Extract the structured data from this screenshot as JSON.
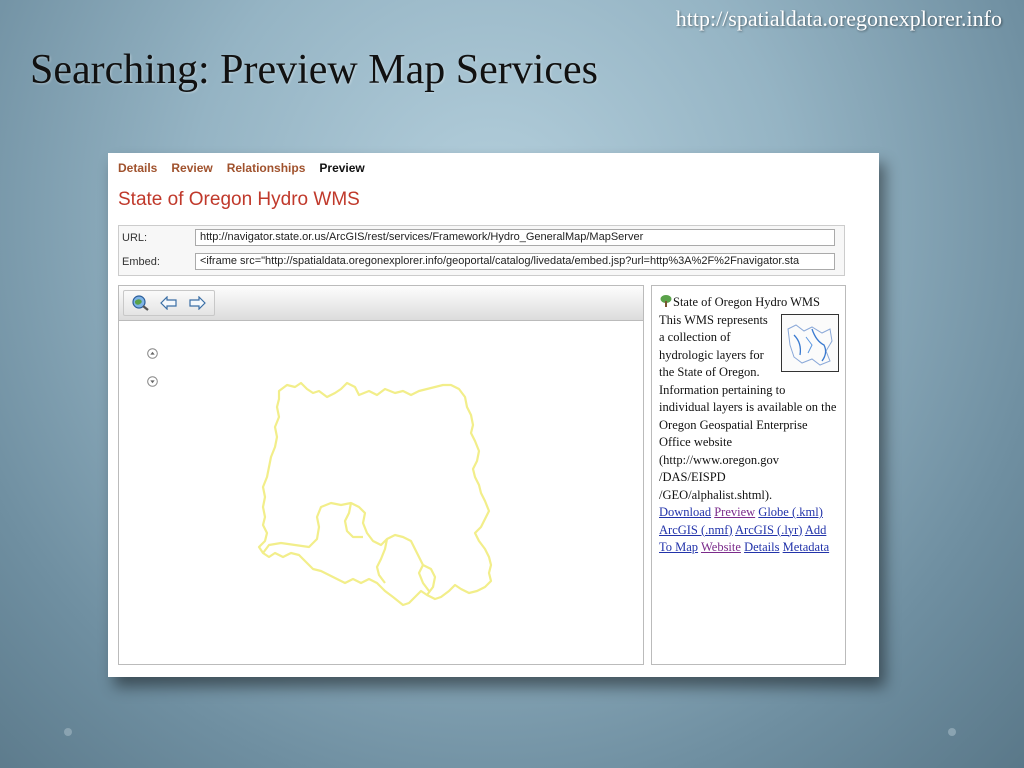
{
  "slide": {
    "source_url": "http://spatialdata.oregonexplorer.info",
    "title": "Searching: Preview Map Services"
  },
  "tabs": [
    {
      "label": "Details",
      "active": false
    },
    {
      "label": "Review",
      "active": false
    },
    {
      "label": "Relationships",
      "active": false
    },
    {
      "label": "Preview",
      "active": true
    }
  ],
  "record": {
    "title": "State of Oregon Hydro WMS"
  },
  "fields": {
    "url_label": "URL:",
    "url_value": "http://navigator.state.or.us/ArcGIS/rest/services/Framework/Hydro_GeneralMap/MapServer",
    "embed_label": "Embed:",
    "embed_value": "<iframe src=\"http://spatialdata.oregonexplorer.info/geoportal/catalog/livedata/embed.jsp?url=http%3A%2F%2Fnavigator.sta"
  },
  "toolbar": {
    "icons": [
      "zoom-extent-icon",
      "back-arrow-icon",
      "forward-arrow-icon"
    ]
  },
  "info": {
    "title": "State of Oregon Hydro WMS",
    "description_part1": "This WMS represents a collection of hydrologic layers",
    "description_part2": "for the State of Oregon. Information pertaining to individual layers is available on the Oregon Geospatial Enterprise Office website (http://www.oregon.gov /DAS/EISPD /GEO/alphalist.shtml).",
    "links": {
      "download": "Download",
      "preview": "Preview",
      "globe": "Globe (.kml)",
      "arcgis_nmf": "ArcGIS (.nmf)",
      "arcgis_lyr": "ArcGIS (.lyr)",
      "add_to_map": "Add To Map",
      "website": "Website",
      "details": "Details",
      "metadata": "Metadata"
    }
  },
  "colors": {
    "tab_link": "#a0522d",
    "record_title": "#c0392b",
    "map_outline": "#f2ee8a",
    "hyperlink": "#2233aa",
    "visited_link": "#7a2a8a"
  }
}
